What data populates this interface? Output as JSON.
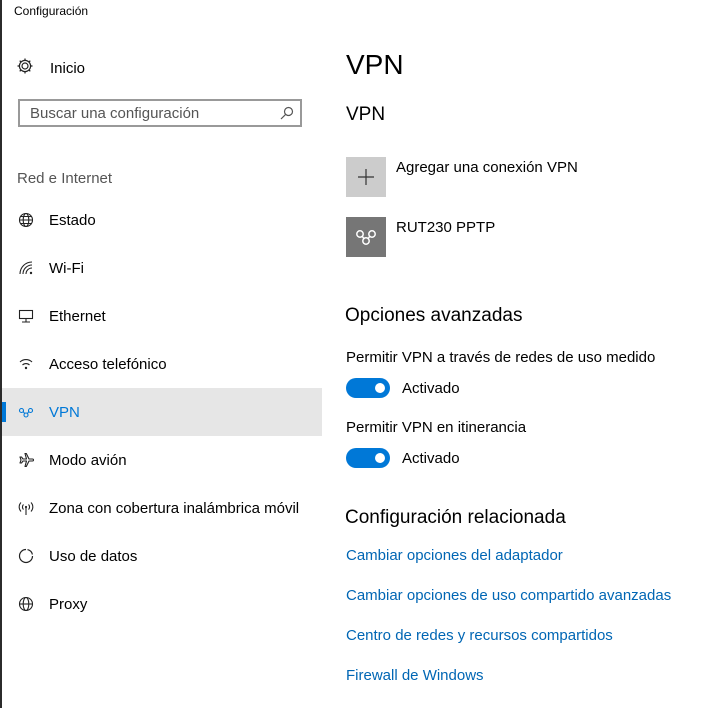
{
  "window": {
    "title": "Configuración"
  },
  "sidebar": {
    "home_label": "Inicio",
    "search_placeholder": "Buscar una configuración",
    "section_title": "Red e Internet",
    "items": [
      {
        "label": "Estado",
        "icon": "globe-status-icon"
      },
      {
        "label": "Wi-Fi",
        "icon": "wifi-icon"
      },
      {
        "label": "Ethernet",
        "icon": "ethernet-icon"
      },
      {
        "label": "Acceso telefónico",
        "icon": "dialup-icon"
      },
      {
        "label": "VPN",
        "icon": "vpn-icon",
        "active": true
      },
      {
        "label": "Modo avión",
        "icon": "airplane-icon"
      },
      {
        "label": "Zona con cobertura inalámbrica móvil",
        "icon": "hotspot-icon"
      },
      {
        "label": "Uso de datos",
        "icon": "data-usage-icon"
      },
      {
        "label": "Proxy",
        "icon": "globe-icon"
      }
    ]
  },
  "main": {
    "title": "VPN",
    "vpn_section_title": "VPN",
    "add_connection_label": "Agregar una conexión VPN",
    "connections": [
      {
        "name": "RUT230 PPTP"
      }
    ],
    "advanced": {
      "title": "Opciones avanzadas",
      "options": [
        {
          "label": "Permitir VPN a través de redes de uso medido",
          "state": "Activado",
          "on": true
        },
        {
          "label": "Permitir VPN en itinerancia",
          "state": "Activado",
          "on": true
        }
      ]
    },
    "related": {
      "title": "Configuración relacionada",
      "links": [
        "Cambiar opciones del adaptador",
        "Cambiar opciones de uso compartido avanzadas",
        "Centro de redes y recursos compartidos",
        "Firewall de Windows"
      ]
    }
  },
  "colors": {
    "accent": "#0078d7",
    "link": "#0066b4",
    "selected_bg": "#e6e6e6",
    "tile_add": "#cccccc",
    "tile_vpn": "#767676"
  }
}
